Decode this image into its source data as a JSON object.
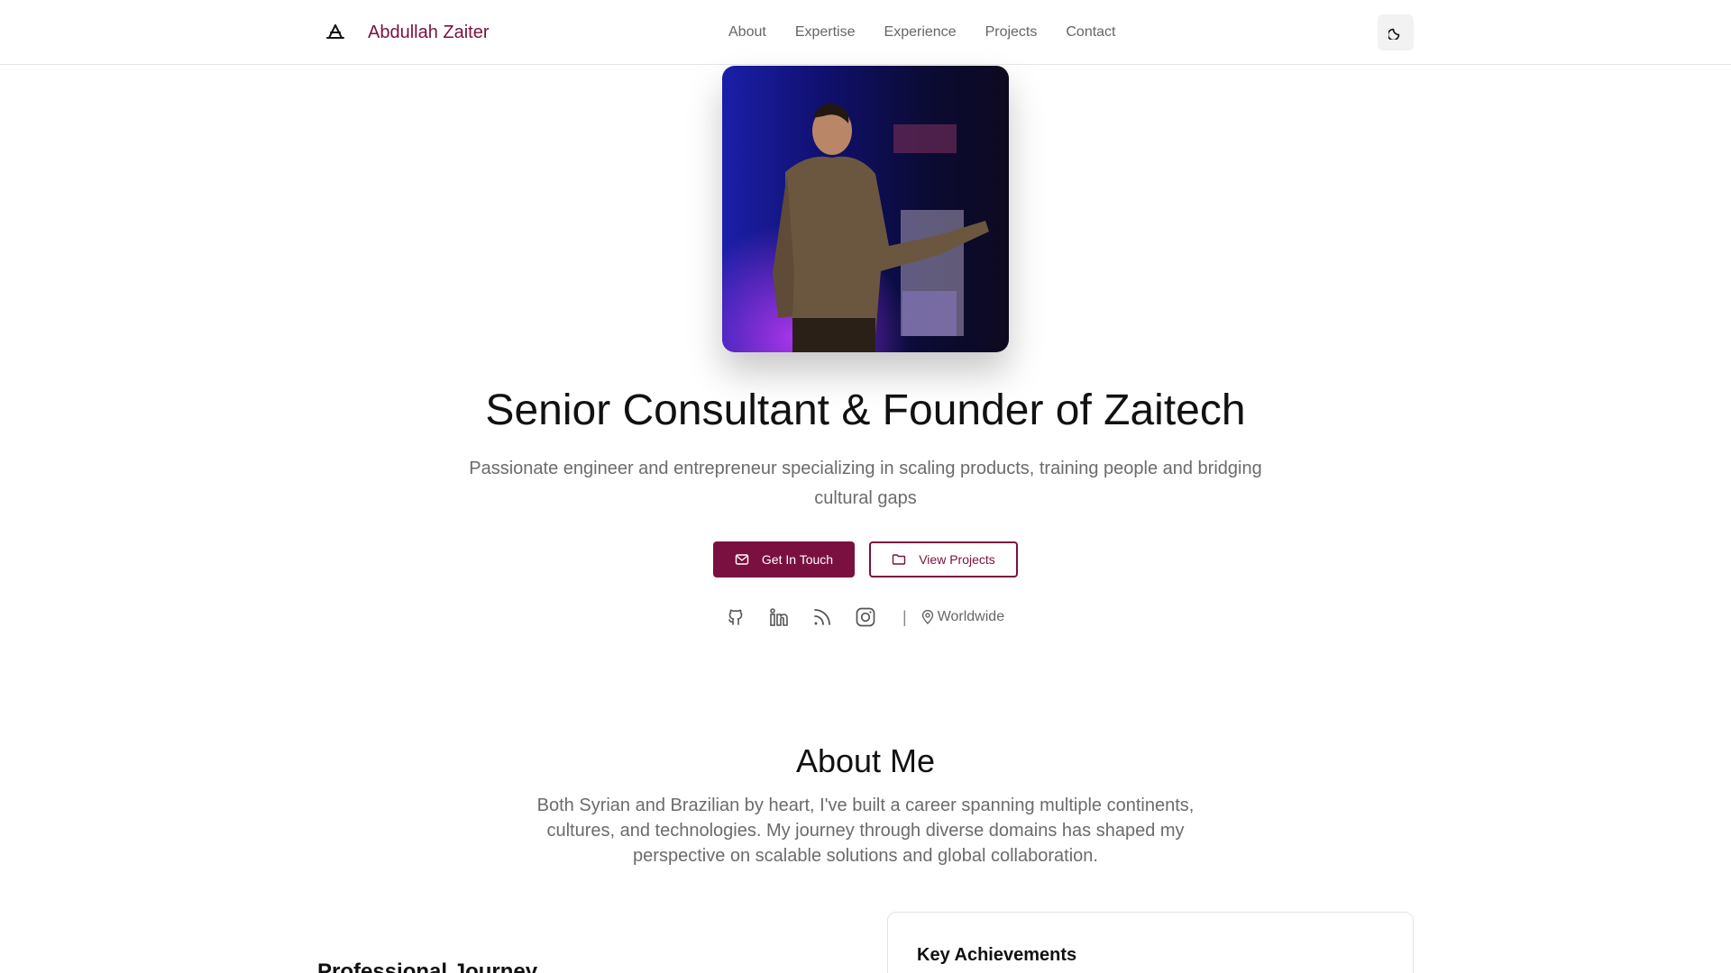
{
  "header": {
    "brand": "Abdullah Zaiter",
    "nav": [
      "About",
      "Expertise",
      "Experience",
      "Projects",
      "Contact"
    ]
  },
  "hero": {
    "title": "Senior Consultant & Founder of Zaitech",
    "subtitle": "Passionate engineer and entrepreneur specializing in scaling products, training people and bridging cultural gaps",
    "primary_button": "Get In Touch",
    "secondary_button": "View Projects",
    "social_icons": [
      "github-icon",
      "linkedin-icon",
      "rss-icon",
      "instagram-icon"
    ],
    "separator": "|",
    "location": "Worldwide"
  },
  "about": {
    "title": "About Me",
    "text": "Both Syrian and Brazilian by heart, I've built a career spanning multiple continents, cultures, and technologies. My journey through diverse domains has shaped my perspective on scalable solutions and global collaboration.",
    "journey_title": "Professional Journey",
    "achievements_title": "Key Achievements"
  },
  "colors": {
    "accent": "#7a1040",
    "muted_text": "#6b6b6b"
  }
}
